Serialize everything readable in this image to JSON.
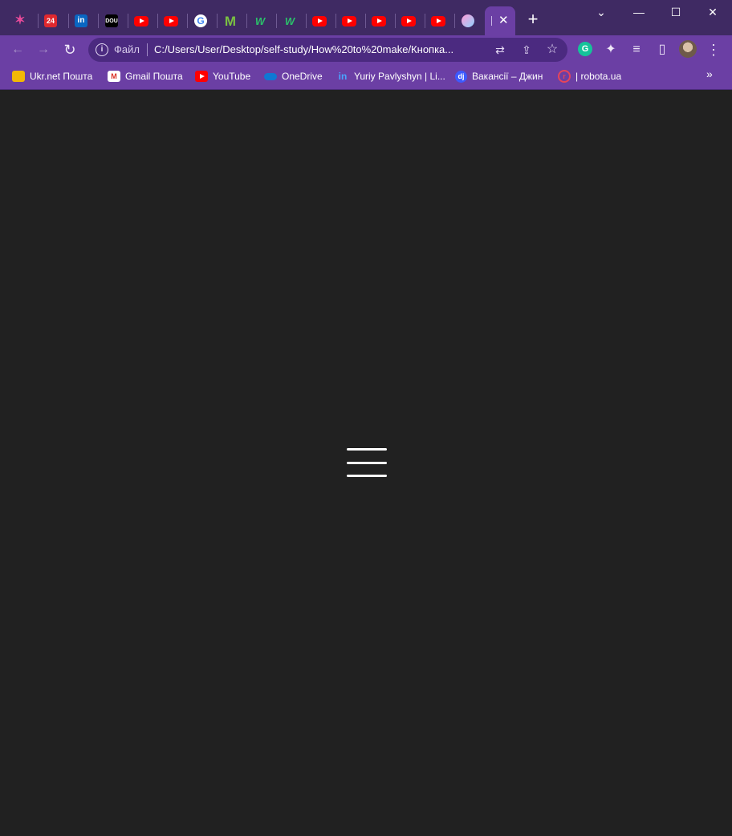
{
  "browser": {
    "tabs": [
      {
        "icon": "app-star-icon",
        "glyph": "✶"
      },
      {
        "icon": "news24-icon",
        "glyph": "24"
      },
      {
        "icon": "linkedin-icon",
        "glyph": "in"
      },
      {
        "icon": "dou-icon",
        "glyph": "DOU"
      },
      {
        "icon": "youtube-icon",
        "glyph": ""
      },
      {
        "icon": "youtube-icon",
        "glyph": ""
      },
      {
        "icon": "google-icon",
        "glyph": "G"
      },
      {
        "icon": "m-icon",
        "glyph": "M"
      },
      {
        "icon": "w-icon",
        "glyph": "W"
      },
      {
        "icon": "w-icon",
        "glyph": "W"
      },
      {
        "icon": "youtube-icon",
        "glyph": ""
      },
      {
        "icon": "youtube-icon",
        "glyph": ""
      },
      {
        "icon": "youtube-icon",
        "glyph": ""
      },
      {
        "icon": "youtube-icon",
        "glyph": ""
      },
      {
        "icon": "youtube-icon",
        "glyph": ""
      },
      {
        "icon": "gradient-circle-icon",
        "glyph": ""
      }
    ],
    "active_tab": {
      "close_glyph": "✕"
    },
    "new_tab_glyph": "+",
    "window_controls": {
      "tabsearch": "⌄",
      "minimize": "—",
      "maximize": "☐",
      "close": "✕"
    },
    "toolbar": {
      "back": "←",
      "forward": "→",
      "reload": "↻",
      "scheme_label": "Файл",
      "url": "C:/Users/User/Desktop/self-study/How%20to%20make/Кнопка...",
      "translate": "⇄",
      "share": "⇪",
      "bookmark_star": "☆",
      "grammarly": "G",
      "extensions": "✦",
      "media": "≡",
      "side_panel": "▯",
      "menu": "⋮"
    },
    "bookmarks": [
      {
        "label": "Ukr.net Пошта",
        "icon": "ukrnet-icon",
        "color": "#f2b705"
      },
      {
        "label": "Gmail Пошта",
        "icon": "gmail-icon",
        "color": "#d93025"
      },
      {
        "label": "YouTube",
        "icon": "youtube-icon",
        "color": "#ff0000"
      },
      {
        "label": "OneDrive",
        "icon": "onedrive-icon",
        "color": "#0f78d4"
      },
      {
        "label": "Yuriy Pavlyshyn | Li...",
        "icon": "linkedin-icon",
        "color": "#0a66c2"
      },
      {
        "label": "Вакансії – Джин",
        "icon": "djinni-icon",
        "color": "#3d5afe"
      },
      {
        "label": "| robota.ua",
        "icon": "robota-icon",
        "color": "#e6455a"
      }
    ],
    "bookmarks_more": "»"
  },
  "page": {
    "background": "#212121",
    "menu_button": {
      "bars": 3,
      "color": "#ffffff"
    }
  }
}
